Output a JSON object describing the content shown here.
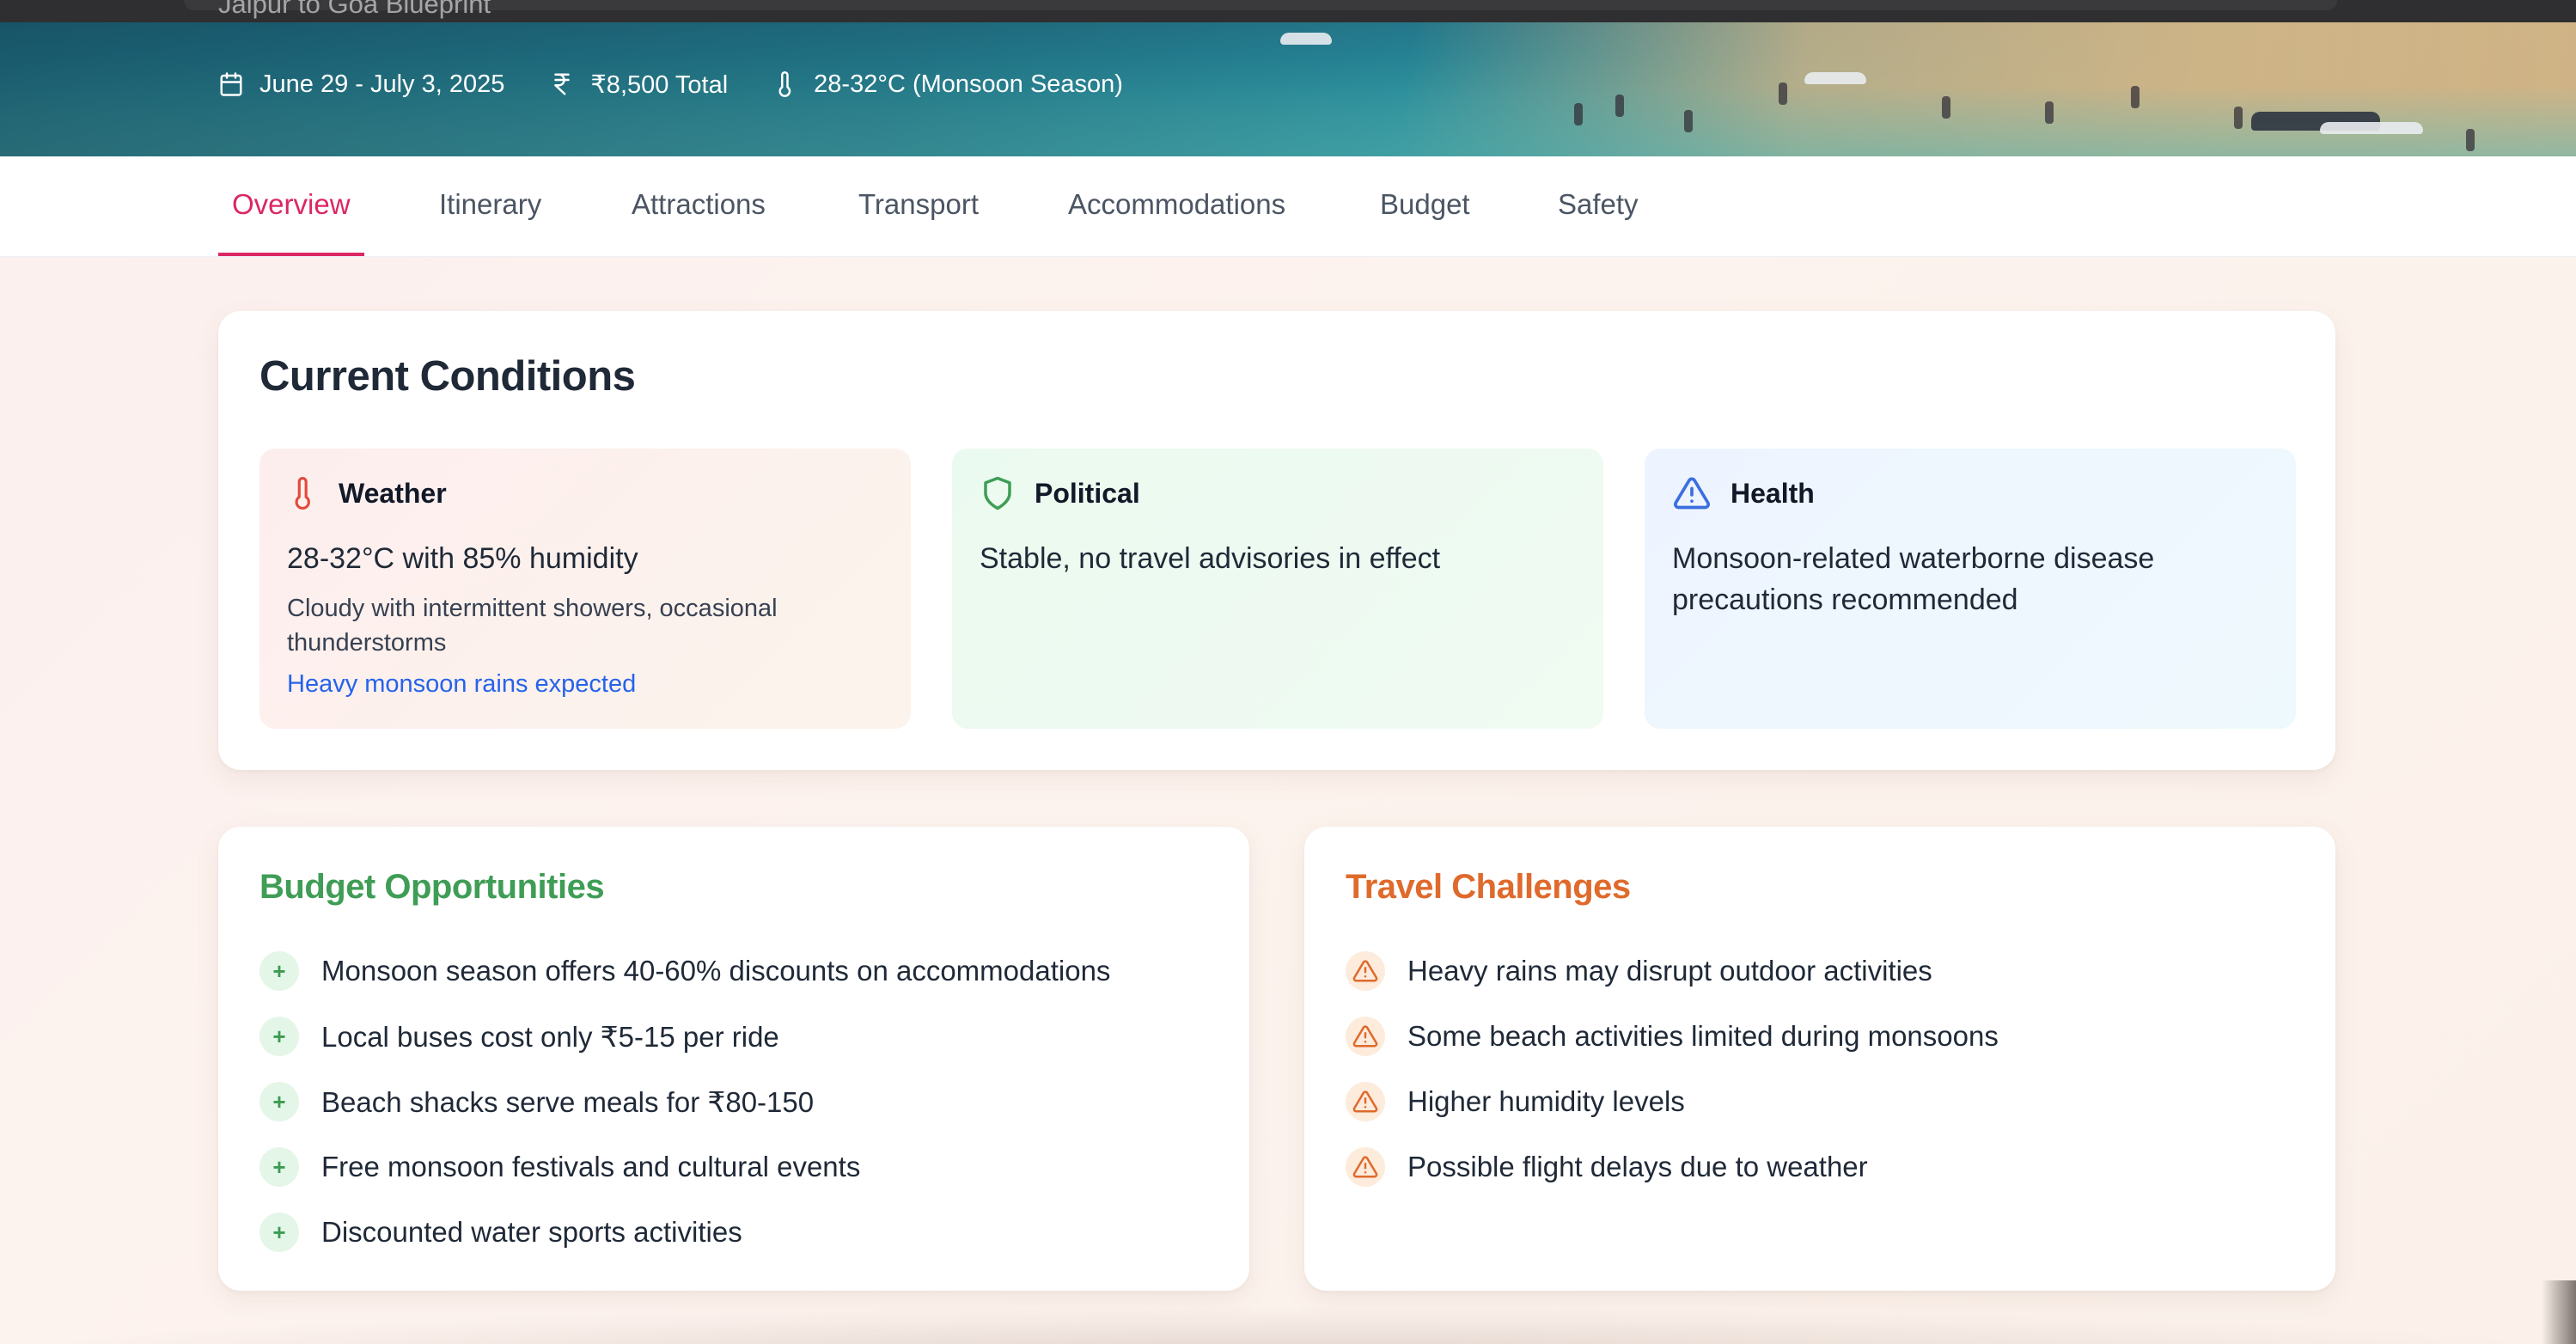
{
  "hero": {
    "subtitle": "Jaipur to Goa Blueprint",
    "meta": [
      {
        "icon": "calendar-icon",
        "text": "June 29 - July 3, 2025"
      },
      {
        "icon": "rupee-icon",
        "text": "₹8,500 Total"
      },
      {
        "icon": "thermometer-icon",
        "text": "28-32°C (Monsoon Season)"
      }
    ]
  },
  "tabs": [
    {
      "label": "Overview",
      "active": true
    },
    {
      "label": "Itinerary"
    },
    {
      "label": "Attractions"
    },
    {
      "label": "Transport"
    },
    {
      "label": "Accommodations"
    },
    {
      "label": "Budget"
    },
    {
      "label": "Safety"
    }
  ],
  "conditions": {
    "title": "Current Conditions",
    "weather": {
      "icon": "thermometer-icon",
      "label": "Weather",
      "main": "28-32°C with 85% humidity",
      "detail": "Cloudy with intermittent showers, occasional thunderstorms",
      "note": "Heavy monsoon rains expected"
    },
    "political": {
      "icon": "shield-icon",
      "label": "Political",
      "main": "Stable, no travel advisories in effect"
    },
    "health": {
      "icon": "warning-icon",
      "label": "Health",
      "main": "Monsoon-related waterborne disease precautions recommended"
    }
  },
  "opportunities": {
    "title": "Budget Opportunities",
    "items": [
      "Monsoon season offers 40-60% discounts on accommodations",
      "Local buses cost only ₹5-15 per ride",
      "Beach shacks serve meals for ₹80-150",
      "Free monsoon festivals and cultural events",
      "Discounted water sports activities"
    ]
  },
  "challenges": {
    "title": "Travel Challenges",
    "items": [
      "Heavy rains may disrupt outdoor activities",
      "Some beach activities limited during monsoons",
      "Higher humidity levels",
      "Possible flight delays due to weather"
    ]
  },
  "colors": {
    "accent": "#db2763",
    "green": "#3f9d55",
    "orange": "#df6a2c",
    "link": "#2563eb"
  }
}
